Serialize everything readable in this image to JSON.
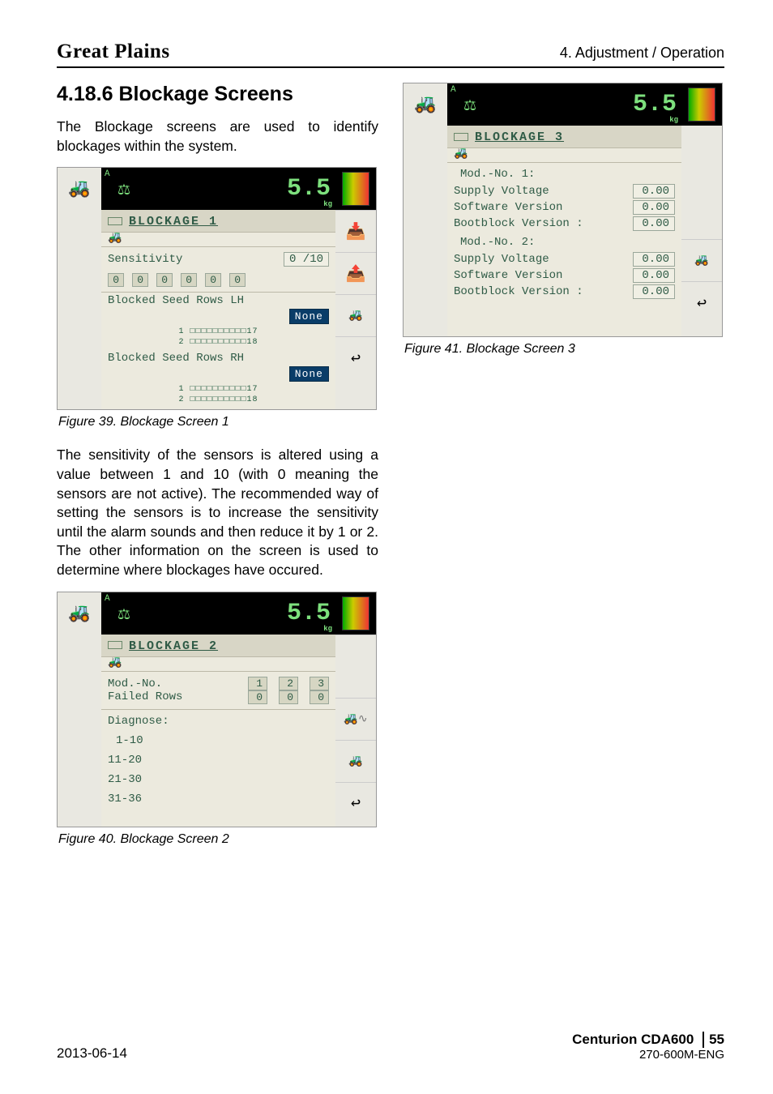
{
  "header": {
    "brand": "Great Plains",
    "section": "4. Adjustment / Operation"
  },
  "section_heading": "4.18.6  Blockage Screens",
  "intro_para": "The Blockage screens are used to identify blockages within the system.",
  "mid_para": "The sensitivity of the sensors is altered using a value between 1 and 10 (with 0 meaning the sensors are not active). The recommended way of setting the sensors is to increase the sensitivity until the alarm sounds and then reduce it by 1 or 2. The other information on the screen is used to determine where blockages have occured.",
  "captions": {
    "fig39": "Figure 39. Blockage Screen 1",
    "fig40": "Figure 40. Blockage Screen 2",
    "fig41": "Figure 41. Blockage Screen 3"
  },
  "lcd_common": {
    "big_number": "5.5",
    "kg": "kg"
  },
  "screen1": {
    "title": "BLOCKAGE 1",
    "sens_label": "Sensitivity",
    "sens_value": "0 /10",
    "cells": [
      "0",
      "0",
      "0",
      "0",
      "0",
      "0"
    ],
    "rows_lh": "Blocked Seed Rows LH",
    "rows_rh": "Blocked Seed Rows RH",
    "none_btn": "None",
    "strip1": "1 □□□□□□□□□□17",
    "strip1b": "2 □□□□□□□□□□18",
    "strip2": "1 □□□□□□□□□□17",
    "strip2b": "2 □□□□□□□□□□18"
  },
  "screen2": {
    "title": "BLOCKAGE 2",
    "mod_label": "Mod.-No.",
    "failed_label": "Failed Rows",
    "mods": [
      "1",
      "2",
      "3"
    ],
    "fails": [
      "0",
      "0",
      "0"
    ],
    "diag_label": "Diagnose:",
    "ranges": [
      "1-10",
      "11-20",
      "21-30",
      "31-36"
    ]
  },
  "screen3": {
    "title": "BLOCKAGE 3",
    "m1": "Mod.-No. 1:",
    "m2": "Mod.-No. 2:",
    "sv": "Supply Voltage",
    "sw": "Software Version",
    "bb": "Bootblock Version :",
    "val": "0.00"
  },
  "footer": {
    "date": "2013-06-14",
    "model": "Centurion CDA600",
    "page": "55",
    "doc": "270-600M-ENG"
  }
}
